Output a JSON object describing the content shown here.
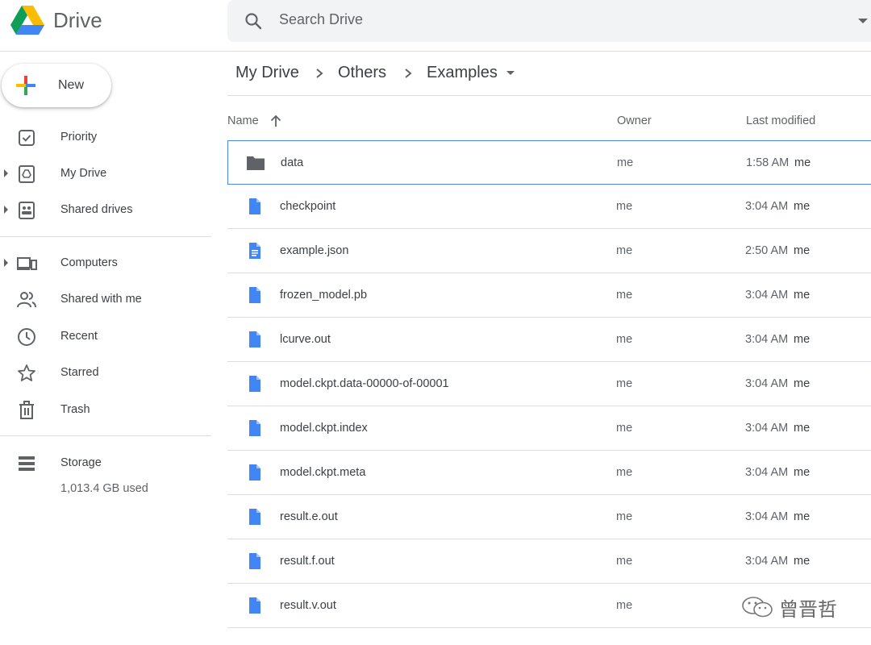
{
  "app": {
    "title": "Drive"
  },
  "search": {
    "placeholder": "Search Drive"
  },
  "sidebar": {
    "new_label": "New",
    "items": [
      {
        "label": "Priority",
        "icon": "priority-icon"
      },
      {
        "label": "My Drive",
        "icon": "my-drive-icon"
      },
      {
        "label": "Shared drives",
        "icon": "shared-drives-icon"
      },
      {
        "label": "Computers",
        "icon": "computers-icon"
      },
      {
        "label": "Shared with me",
        "icon": "shared-with-me-icon"
      },
      {
        "label": "Recent",
        "icon": "recent-icon"
      },
      {
        "label": "Starred",
        "icon": "star-icon"
      },
      {
        "label": "Trash",
        "icon": "trash-icon"
      },
      {
        "label": "Storage",
        "icon": "storage-icon"
      }
    ],
    "storage_used": "1,013.4 GB used"
  },
  "breadcrumb": [
    "My Drive",
    "Others",
    "Examples"
  ],
  "columns": {
    "name": "Name",
    "owner": "Owner",
    "modified": "Last modified"
  },
  "files": [
    {
      "name": "data",
      "type": "folder",
      "owner": "me",
      "time": "1:58 AM",
      "by": "me"
    },
    {
      "name": "checkpoint",
      "type": "file",
      "owner": "me",
      "time": "3:04 AM",
      "by": "me"
    },
    {
      "name": "example.json",
      "type": "doc",
      "owner": "me",
      "time": "2:50 AM",
      "by": "me"
    },
    {
      "name": "frozen_model.pb",
      "type": "file",
      "owner": "me",
      "time": "3:04 AM",
      "by": "me"
    },
    {
      "name": "lcurve.out",
      "type": "file",
      "owner": "me",
      "time": "3:04 AM",
      "by": "me"
    },
    {
      "name": "model.ckpt.data-00000-of-00001",
      "type": "file",
      "owner": "me",
      "time": "3:04 AM",
      "by": "me"
    },
    {
      "name": "model.ckpt.index",
      "type": "file",
      "owner": "me",
      "time": "3:04 AM",
      "by": "me"
    },
    {
      "name": "model.ckpt.meta",
      "type": "file",
      "owner": "me",
      "time": "3:04 AM",
      "by": "me"
    },
    {
      "name": "result.e.out",
      "type": "file",
      "owner": "me",
      "time": "3:04 AM",
      "by": "me"
    },
    {
      "name": "result.f.out",
      "type": "file",
      "owner": "me",
      "time": "3:04 AM",
      "by": "me"
    },
    {
      "name": "result.v.out",
      "type": "file",
      "owner": "me",
      "time": "",
      "by": ""
    }
  ],
  "watermark": {
    "text": "曾晋哲"
  },
  "colors": {
    "file_blue": "#4285f4",
    "folder_gray": "#5f6368",
    "selection_border": "#4a86e8"
  }
}
